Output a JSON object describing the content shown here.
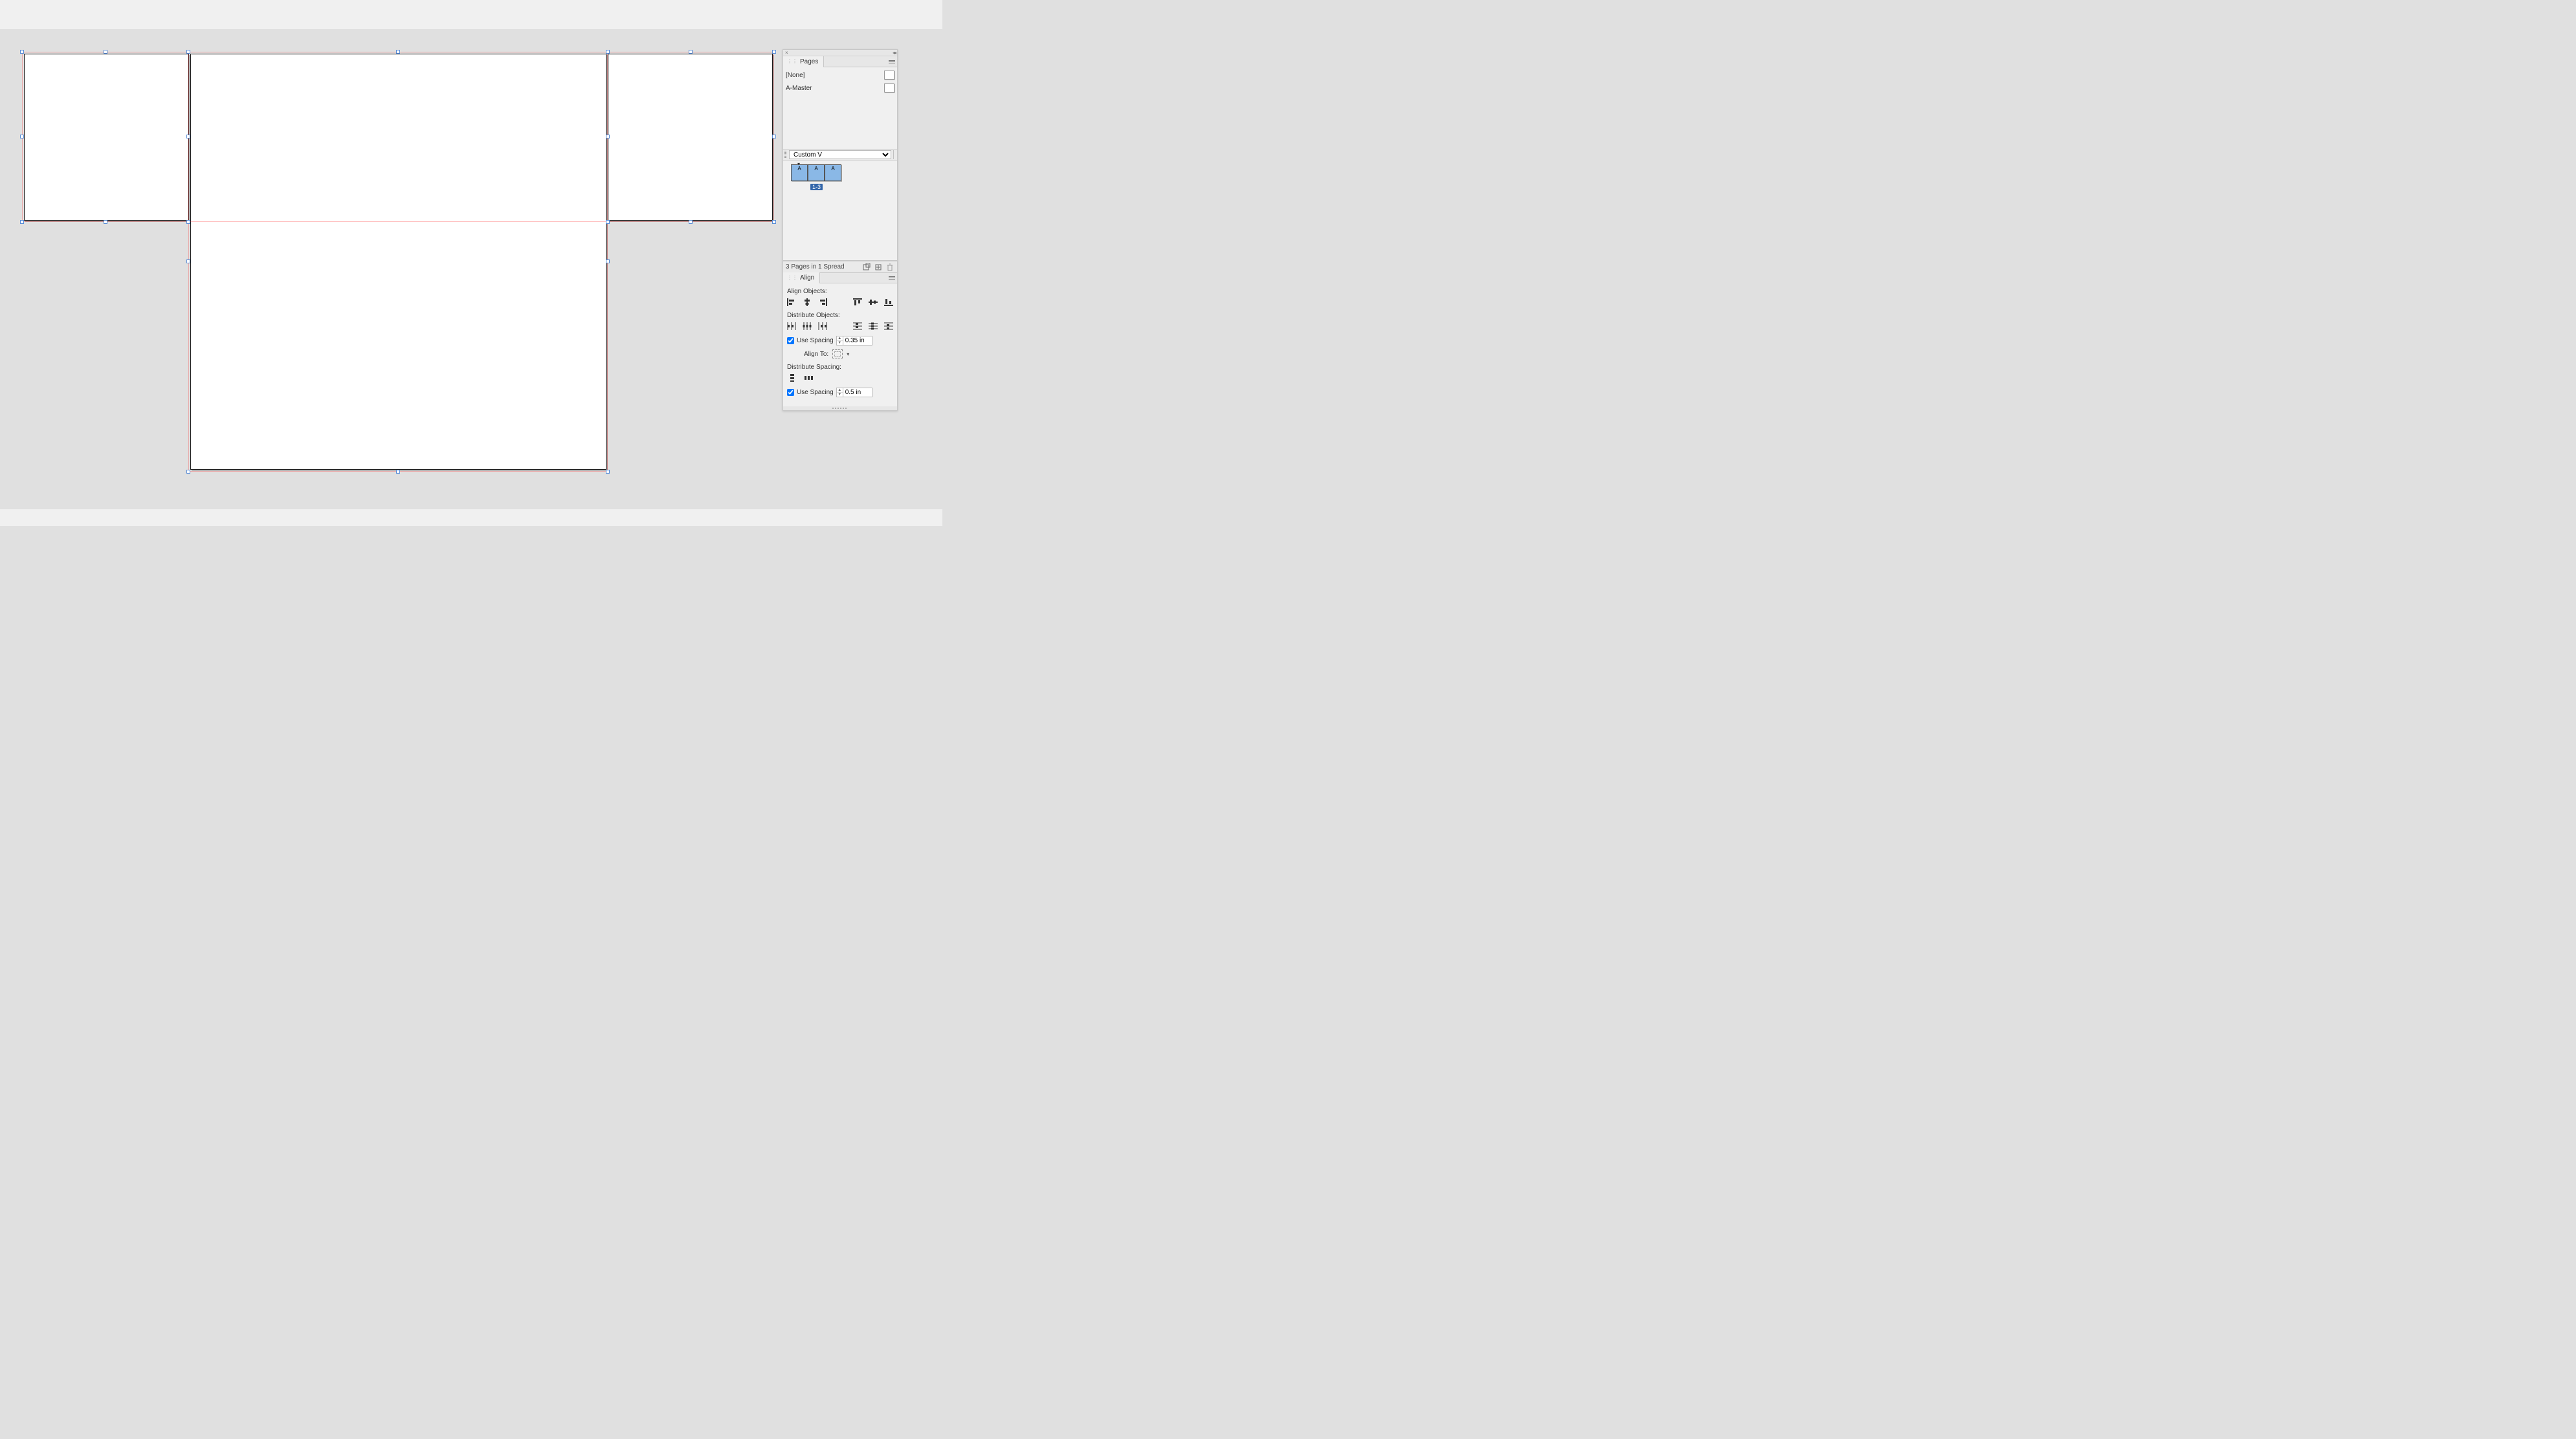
{
  "panels": {
    "pages": {
      "tab_label": "Pages",
      "masters": {
        "none": "[None]",
        "a_master": "A-Master"
      },
      "view_mode": "Custom V",
      "spread_thumb_labels": [
        "A",
        "A",
        "A"
      ],
      "spread_range_label": "1-3",
      "footer_status": "3 Pages in 1 Spread"
    },
    "align": {
      "tab_label": "Align",
      "section_align_objects": "Align Objects:",
      "section_distribute_objects": "Distribute Objects:",
      "use_spacing_label": "Use Spacing",
      "use_spacing_value_1": "0.35 in",
      "align_to_label": "Align To:",
      "section_distribute_spacing": "Distribute Spacing:",
      "use_spacing_value_2": "0.5 in"
    }
  }
}
